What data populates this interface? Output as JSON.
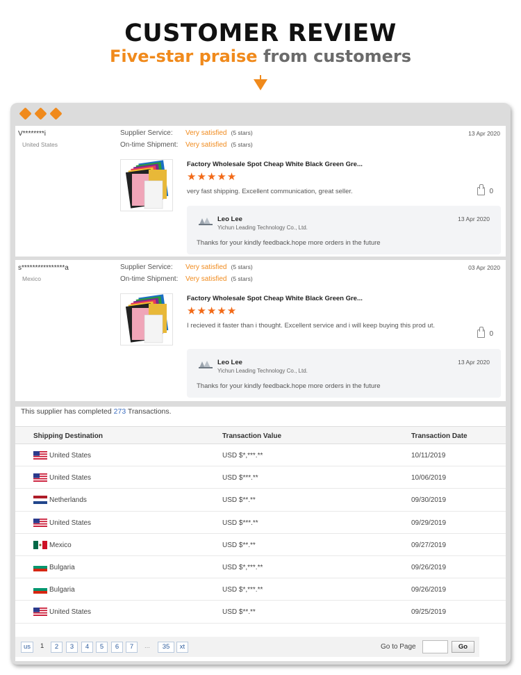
{
  "header": {
    "title": "CUSTOMER REVIEW",
    "subtitle_accent": "Five-star praise",
    "subtitle_rest": " from customers"
  },
  "colors": {
    "accent": "#f08a1c",
    "stars": "#f26a18",
    "link": "#3c6ec0"
  },
  "reviews": [
    {
      "buyer": "V********i",
      "country": "United States",
      "supplier_service_label": "Supplier Service:",
      "supplier_service_value": "Very satisfied",
      "supplier_service_stars": "(5 stars)",
      "shipment_label": "On-time Shipment:",
      "shipment_value": "Very satisfied",
      "shipment_stars": "(5 stars)",
      "date": "13 Apr 2020",
      "product": "Factory Wholesale Spot Cheap White Black Green Gre...",
      "rating_stars": "★★★★★",
      "rating": 5,
      "text": "very fast shipping. Excellent communication, great seller.",
      "likes": "0",
      "reply": {
        "name": "Leo Lee",
        "company": "Yichun Leading Technology Co., Ltd.",
        "date": "13 Apr 2020",
        "text": "Thanks for your kindly feedback.hope more orders in the future"
      }
    },
    {
      "buyer": "s****************a",
      "country": "Mexico",
      "supplier_service_label": "Supplier Service:",
      "supplier_service_value": "Very satisfied",
      "supplier_service_stars": "(5 stars)",
      "shipment_label": "On-time Shipment:",
      "shipment_value": "Very satisfied",
      "shipment_stars": "(5 stars)",
      "date": "03 Apr 2020",
      "product": "Factory Wholesale Spot Cheap White Black Green Gre...",
      "rating_stars": "★★★★★",
      "rating": 5,
      "text": "I recieved it faster than i thought. Excellent service and i will keep buying this prod ut.",
      "likes": "0",
      "reply": {
        "name": "Leo Lee",
        "company": "Yichun Leading Technology Co., Ltd.",
        "date": "13 Apr 2020",
        "text": "Thanks for your kindly feedback.hope more orders in the future"
      }
    }
  ],
  "transactions": {
    "summary_prefix": "This supplier has completed ",
    "count": "273",
    "summary_suffix": " Transactions.",
    "headers": [
      "Shipping Destination",
      "Transaction Value",
      "Transaction Date"
    ],
    "rows": [
      {
        "flag": "us",
        "country": "United States",
        "value": "USD $*,***.**",
        "date": "10/11/2019"
      },
      {
        "flag": "us",
        "country": "United States",
        "value": "USD $***.**",
        "date": "10/06/2019"
      },
      {
        "flag": "nl",
        "country": "Netherlands",
        "value": "USD $**.**",
        "date": "09/30/2019"
      },
      {
        "flag": "us",
        "country": "United States",
        "value": "USD $***.**",
        "date": "09/29/2019"
      },
      {
        "flag": "mx",
        "country": "Mexico",
        "value": "USD $**.**",
        "date": "09/27/2019"
      },
      {
        "flag": "bg",
        "country": "Bulgaria",
        "value": "USD $*,***.**",
        "date": "09/26/2019"
      },
      {
        "flag": "bg",
        "country": "Bulgaria",
        "value": "USD $*,***.**",
        "date": "09/26/2019"
      },
      {
        "flag": "us",
        "country": "United States",
        "value": "USD $**.**",
        "date": "09/25/2019"
      }
    ]
  },
  "pagination": {
    "prev": "us",
    "current": "1",
    "pages": [
      "2",
      "3",
      "4",
      "5",
      "6",
      "7"
    ],
    "ellipsis": "...",
    "last": "35",
    "next": "xt",
    "goto_label": "Go to Page",
    "goto_value": "",
    "go_button": "Go"
  }
}
